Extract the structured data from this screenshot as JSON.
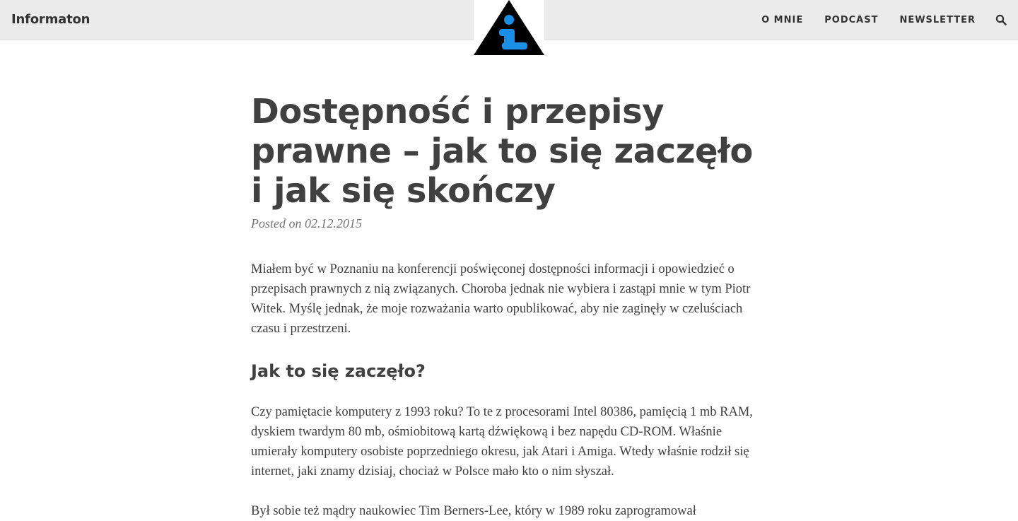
{
  "site": {
    "brand": "Informaton"
  },
  "nav": {
    "items": [
      "O MNIE",
      "PODCAST",
      "NEWSLETTER"
    ],
    "search_icon": "search-icon"
  },
  "logo": {
    "icon": "info-warning-triangle-icon",
    "colors": {
      "triangle": "#000000",
      "glyph": "#1a8fe8"
    }
  },
  "article": {
    "title": "Dostępność i przepisy prawne – jak to się zaczęło i jak się skończy",
    "meta": "Posted on 02.12.2015",
    "intro": "Miałem być w Poznaniu na konferencji poświęconej dostępności informacji i opowiedzieć o przepisach prawnych z nią związanych. Choroba jednak nie wybiera i zastąpi mnie w tym Piotr Witek. Myślę jednak, że moje rozważania warto opublikować, aby nie zaginęły w czeluściach czasu i przestrzeni.",
    "heading1": "Jak to się zaczęło?",
    "para2": "Czy pamiętacie komputery z 1993 roku? To te z procesorami Intel 80386, pamięcią 1 mb RAM, dyskiem twardym 80 mb, ośmiobitową kartą dźwiękową i bez napędu CD-ROM. Właśnie umierały komputery osobiste poprzedniego okresu, jak Atari i Amiga. Wtedy właśnie rodził się internet, jaki znamy dzisiaj, chociaż w Polsce mało kto o nim słyszał.",
    "para3": "Był sobie też mądry naukowiec Tim Berners-Lee, który w 1989 roku zaprogramował"
  },
  "colors": {
    "topbar_bg": "#ebebeb",
    "text": "#404040",
    "meta": "#757575"
  }
}
